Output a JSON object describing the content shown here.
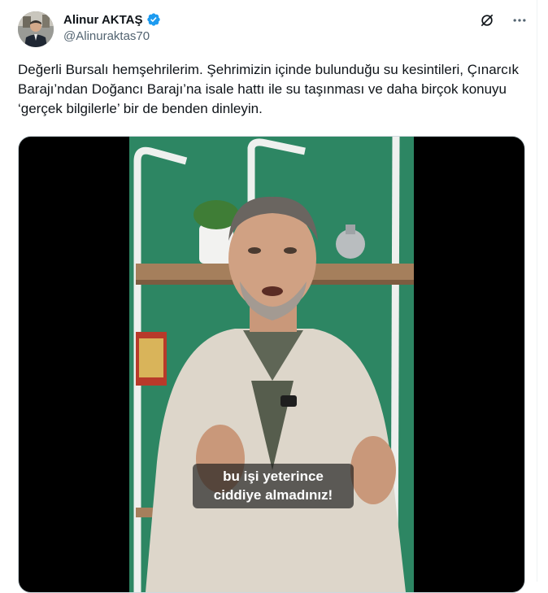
{
  "author": {
    "display_name": "Alinur AKTAŞ",
    "handle": "@Alinuraktas70",
    "verified": true,
    "verified_color": "#1d9bf0",
    "avatar_icon": "profile-photo"
  },
  "actions": {
    "grok_icon": "grok-icon",
    "more_icon": "more-options-icon"
  },
  "tweet": {
    "text": "Değerli Bursalı hemşehrilerim. Şehrimizin içinde bulunduğu su kesintileri, Çınarcık Barajı’ndan Doğancı Barajı’na isale hattı ile su taşınması ve daha birçok konuyu ‘gerçek bilgilerle’ bir de benden dinleyin."
  },
  "video": {
    "subtitle_line1": "bu işi yeterince",
    "subtitle_line2": "ciddiye almadınız!",
    "background_color": "#2f8a66"
  }
}
